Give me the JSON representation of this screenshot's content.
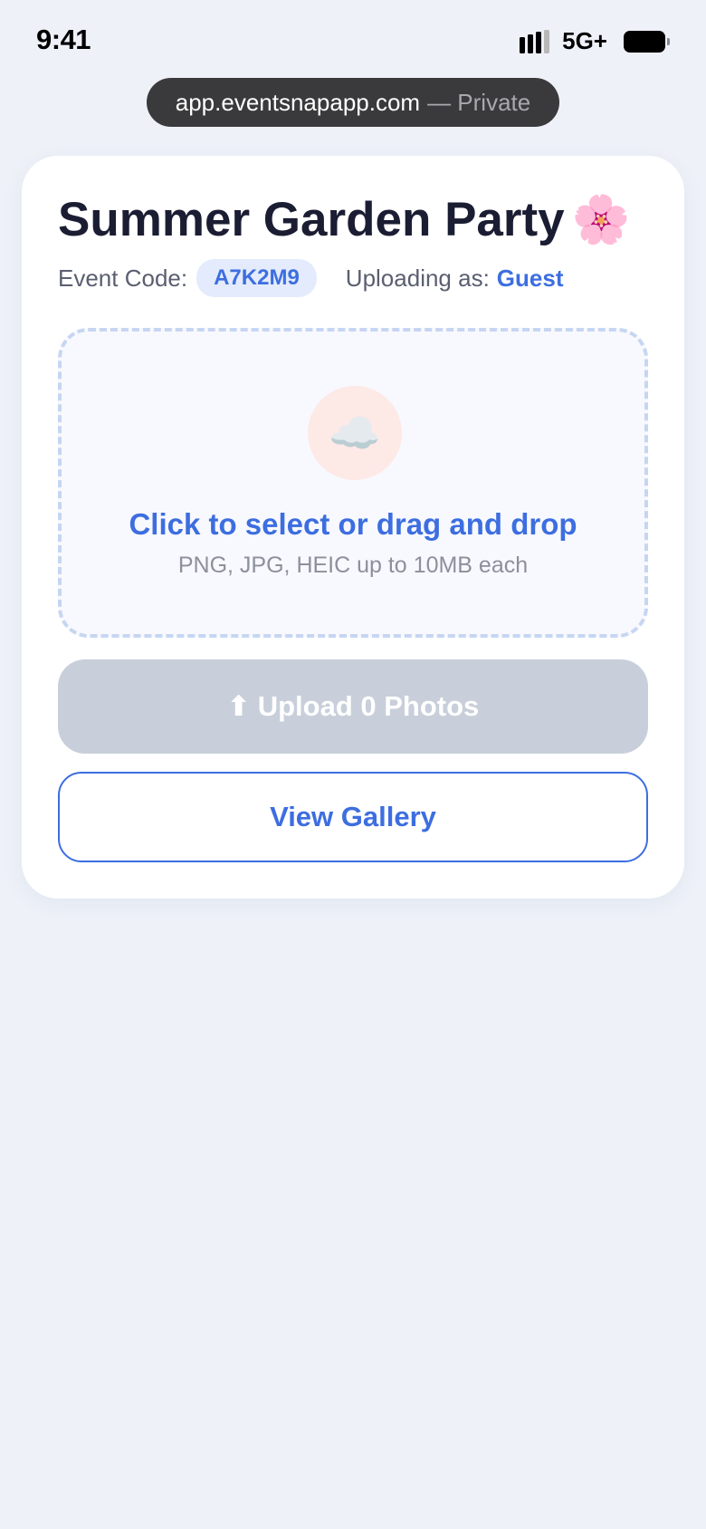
{
  "status_bar": {
    "time": "9:41",
    "network": "5G+",
    "signal_bars_active": 3,
    "signal_bars_total": 4
  },
  "browser": {
    "url": "app.eventsnapapp.com",
    "mode": "— Private"
  },
  "event": {
    "title": "Summer Garden Party",
    "title_emoji": "🌸",
    "code_label": "Event Code:",
    "code": "A7K2M9",
    "uploader_label": "Uploading as:",
    "uploader_name": "Guest"
  },
  "dropzone": {
    "icon": "☁️",
    "title": "Click to select or drag and drop",
    "hint": "PNG, JPG, HEIC up to 10MB each"
  },
  "actions": {
    "upload_arrow": "⬆",
    "upload_label": "Upload 0 Photos",
    "gallery_label": "View Gallery"
  },
  "colors": {
    "accent": "#3d6ee0",
    "background": "#eef1f8",
    "disabled_button": "#c8cfda"
  }
}
